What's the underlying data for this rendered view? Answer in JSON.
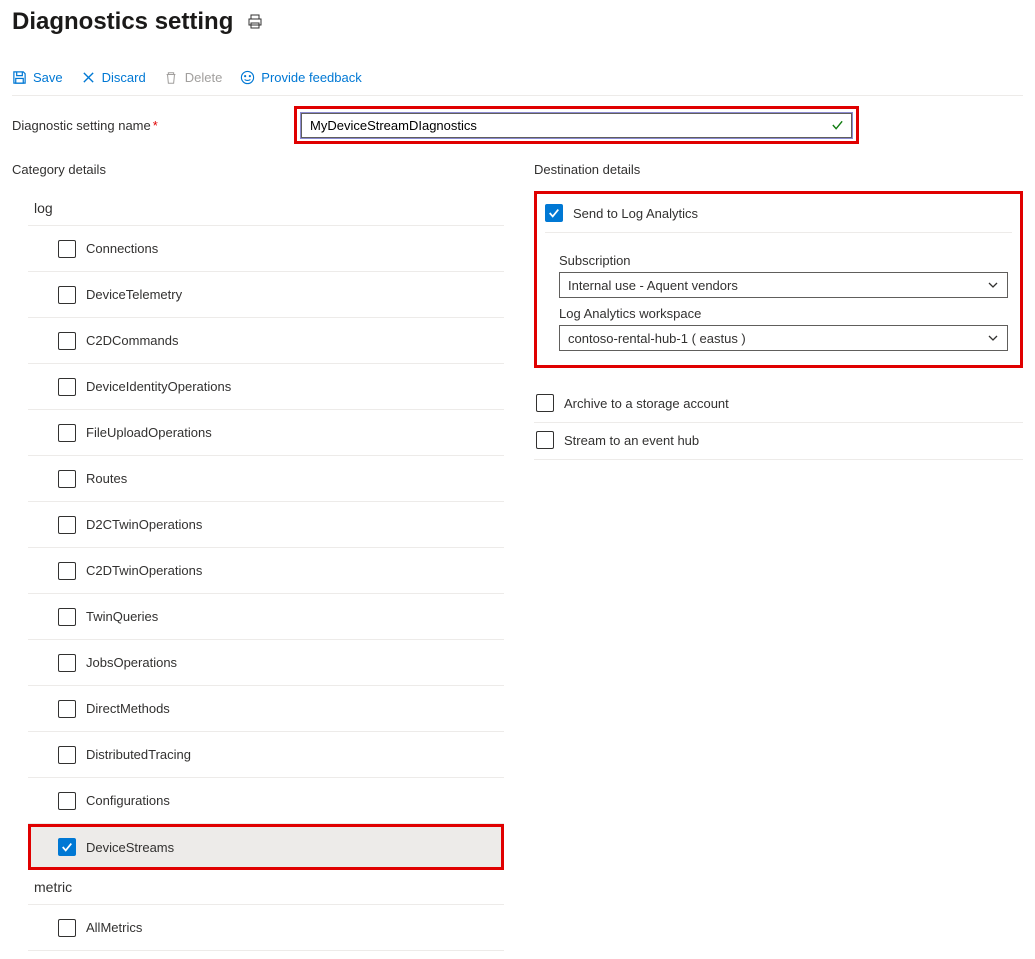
{
  "page_title": "Diagnostics setting",
  "toolbar": {
    "save": "Save",
    "discard": "Discard",
    "delete": "Delete",
    "feedback": "Provide feedback"
  },
  "name_field": {
    "label": "Diagnostic setting name",
    "value": "MyDeviceStreamDIagnostics"
  },
  "category": {
    "title": "Category details",
    "log_group": "log",
    "metric_group": "metric",
    "logs": [
      {
        "label": "Connections",
        "checked": false
      },
      {
        "label": "DeviceTelemetry",
        "checked": false
      },
      {
        "label": "C2DCommands",
        "checked": false
      },
      {
        "label": "DeviceIdentityOperations",
        "checked": false
      },
      {
        "label": "FileUploadOperations",
        "checked": false
      },
      {
        "label": "Routes",
        "checked": false
      },
      {
        "label": "D2CTwinOperations",
        "checked": false
      },
      {
        "label": "C2DTwinOperations",
        "checked": false
      },
      {
        "label": "TwinQueries",
        "checked": false
      },
      {
        "label": "JobsOperations",
        "checked": false
      },
      {
        "label": "DirectMethods",
        "checked": false
      },
      {
        "label": "DistributedTracing",
        "checked": false
      },
      {
        "label": "Configurations",
        "checked": false
      },
      {
        "label": "DeviceStreams",
        "checked": true
      }
    ],
    "metrics": [
      {
        "label": "AllMetrics",
        "checked": false
      }
    ]
  },
  "destination": {
    "title": "Destination details",
    "log_analytics": {
      "label": "Send to Log Analytics",
      "checked": true,
      "subscription_label": "Subscription",
      "subscription_value": "Internal use - Aquent vendors",
      "workspace_label": "Log Analytics workspace",
      "workspace_value": "contoso-rental-hub-1 ( eastus )"
    },
    "storage": {
      "label": "Archive to a storage account",
      "checked": false
    },
    "eventhub": {
      "label": "Stream to an event hub",
      "checked": false
    }
  }
}
